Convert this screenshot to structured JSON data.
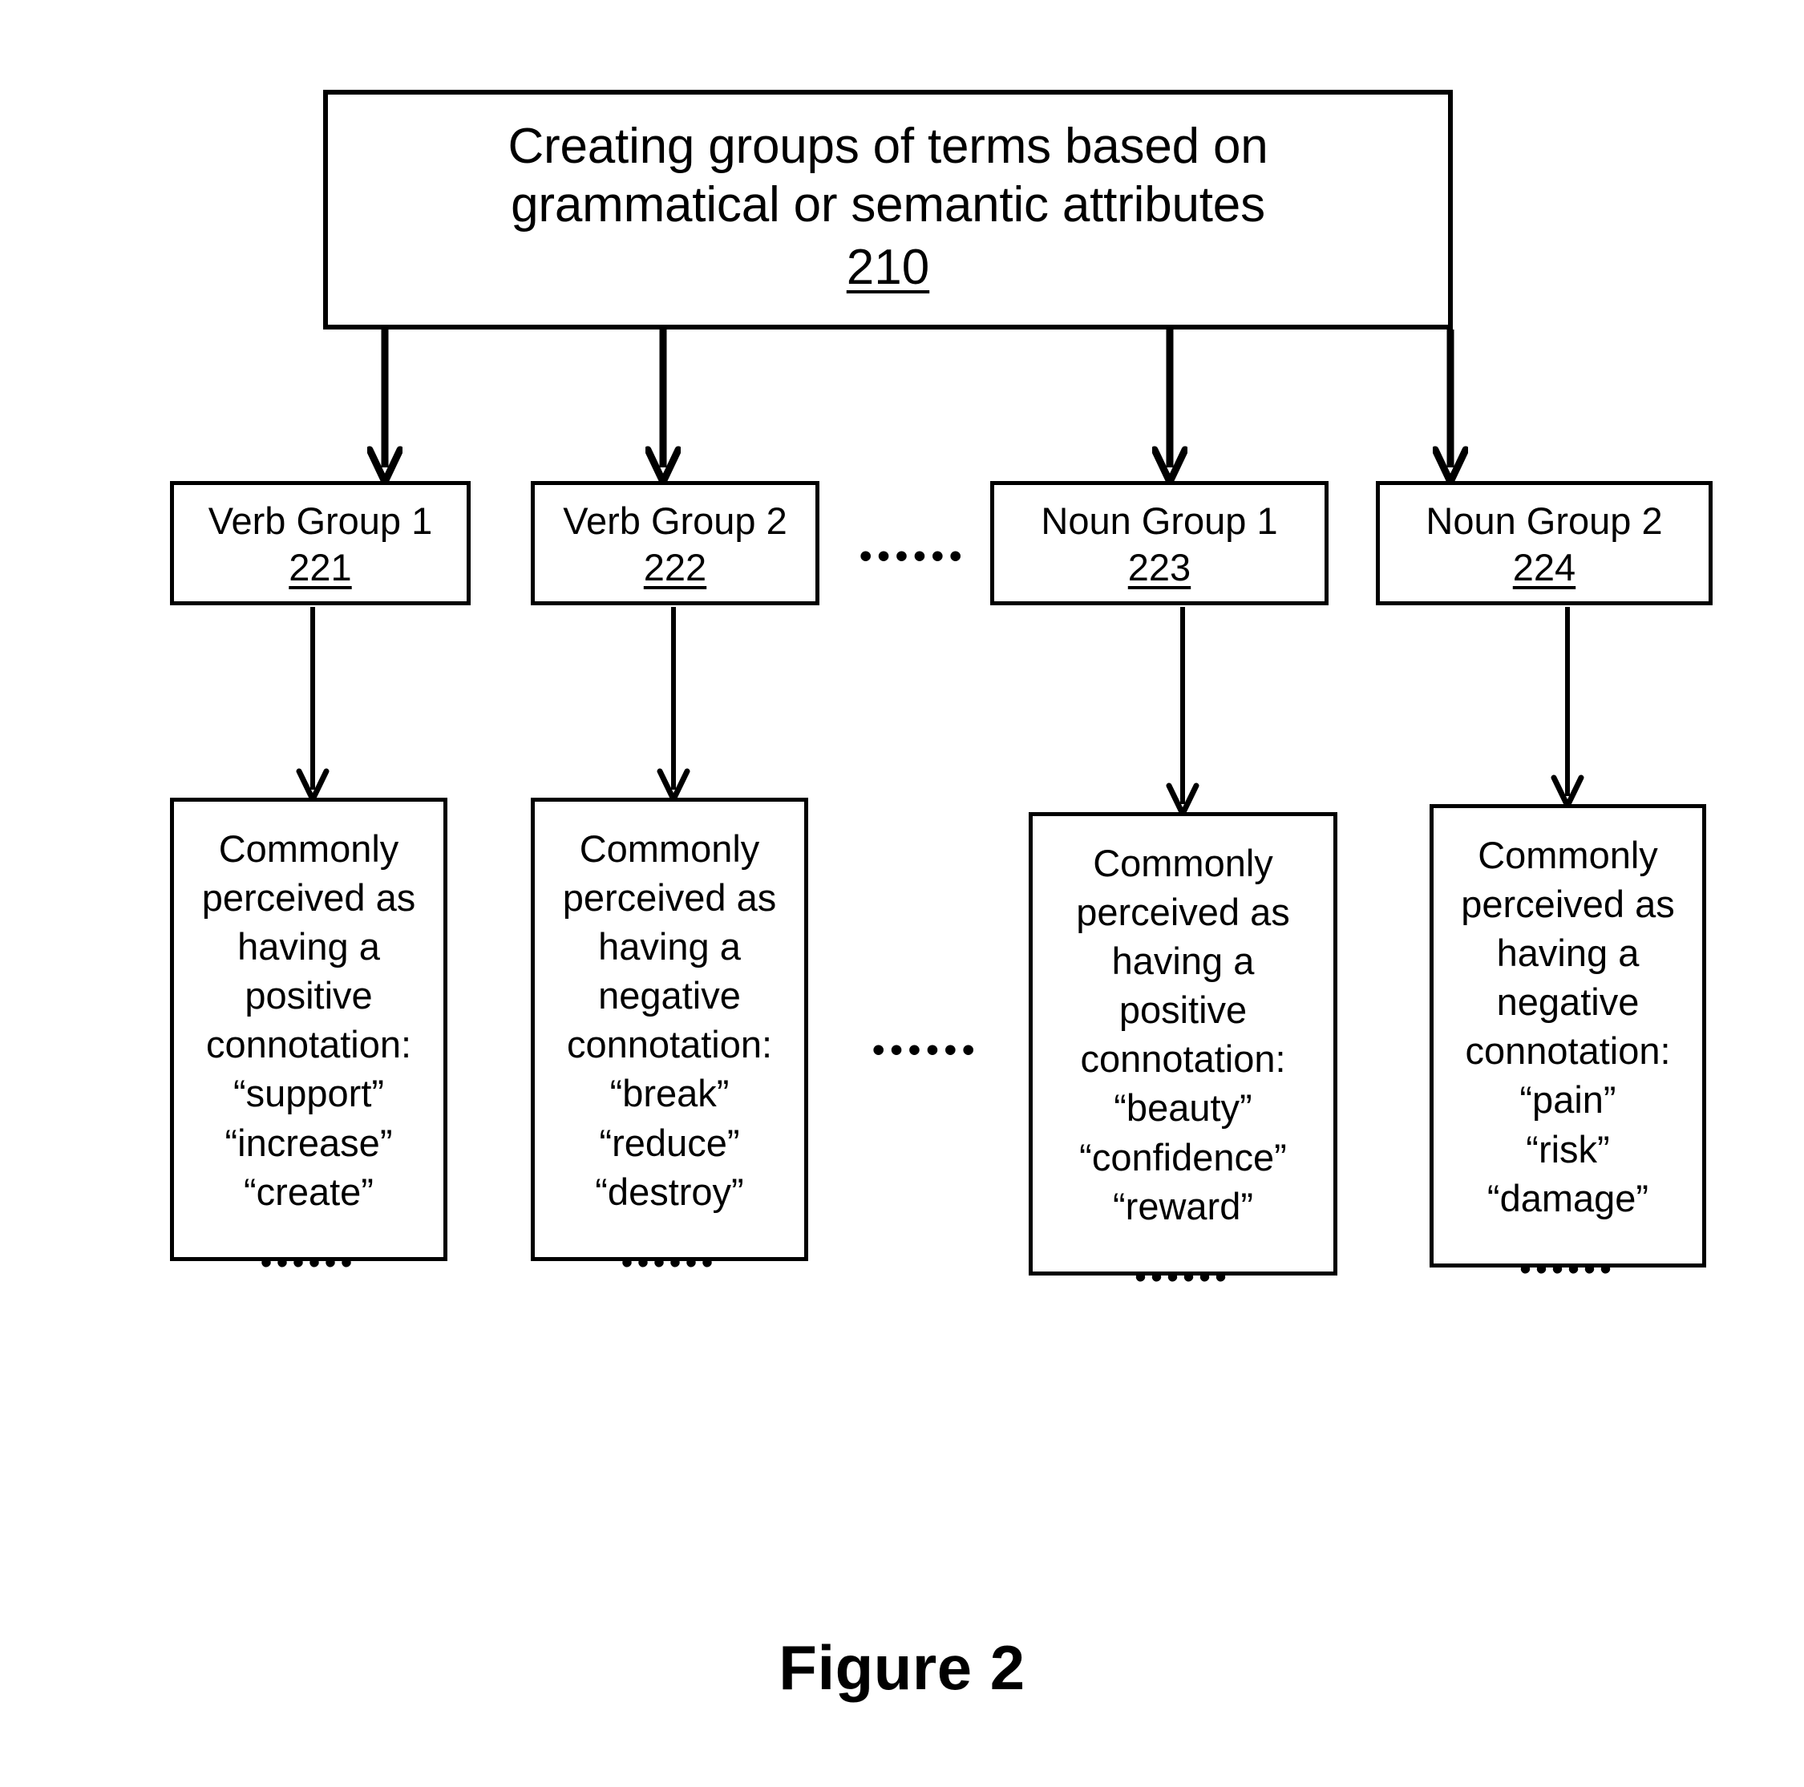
{
  "figure": {
    "caption": "Figure 2"
  },
  "top_box": {
    "line1": "Creating groups of terms based on",
    "line2": "grammatical or semantic attributes",
    "ref": "210"
  },
  "groups": [
    {
      "label": "Verb Group 1",
      "ref": "221"
    },
    {
      "label": "Verb Group 2",
      "ref": "222"
    },
    {
      "label": "Noun Group 1",
      "ref": "223"
    },
    {
      "label": "Noun Group 2",
      "ref": "224"
    }
  ],
  "separators": {
    "groups_ellipsis": "••••••",
    "details_ellipsis": "••••••"
  },
  "details": [
    {
      "l1": "Commonly",
      "l2": "perceived as",
      "l3": "having a",
      "l4": "positive",
      "l5": "connotation:",
      "t1": "“support”",
      "t2": "“increase”",
      "t3": "“create”",
      "dots": "••••••"
    },
    {
      "l1": "Commonly",
      "l2": "perceived as",
      "l3": "having a",
      "l4": "negative",
      "l5": "connotation:",
      "t1": "“break”",
      "t2": "“reduce”",
      "t3": "“destroy”",
      "dots": "••••••"
    },
    {
      "l1": "Commonly",
      "l2": "perceived as",
      "l3": "having a",
      "l4": "positive",
      "l5": "connotation:",
      "t1": "“beauty”",
      "t2": "“confidence”",
      "t3": "“reward”",
      "dots": "••••••"
    },
    {
      "l1": "Commonly",
      "l2": "perceived as",
      "l3": "having a",
      "l4": "negative",
      "l5": "connotation:",
      "t1": "“pain”",
      "t2": "“risk”",
      "t3": "“damage”",
      "dots": "••••••"
    }
  ],
  "colors": {
    "line": "#000000",
    "background": "#ffffff"
  }
}
